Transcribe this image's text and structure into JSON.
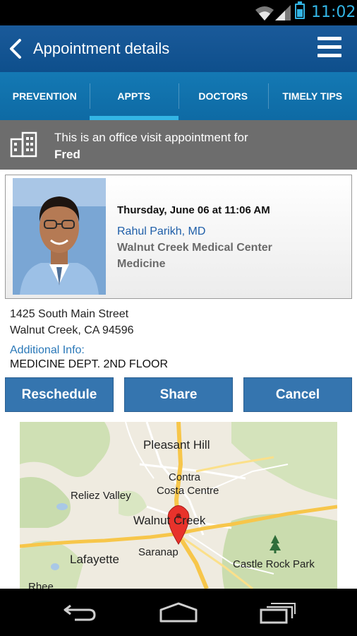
{
  "status_bar": {
    "time": "11:02"
  },
  "header": {
    "title": "Appointment details"
  },
  "tabs": [
    {
      "label": "PREVENTION"
    },
    {
      "label": "APPTS"
    },
    {
      "label": "DOCTORS"
    },
    {
      "label": "TIMELY TIPS"
    }
  ],
  "banner": {
    "line1": "This is an office visit appointment for",
    "patient": "Fred"
  },
  "appointment": {
    "datetime": "Thursday, June 06 at 11:06 AM",
    "doctor": "Rahul Parikh, MD",
    "facility": "Walnut Creek Medical Center",
    "department": "Medicine"
  },
  "address": {
    "line1": "1425 South Main Street",
    "line2": "Walnut Creek, CA 94596"
  },
  "additional_info": {
    "label": "Additional Info:",
    "value": "MEDICINE DEPT. 2ND FLOOR"
  },
  "actions": {
    "reschedule": "Reschedule",
    "share": "Share",
    "cancel": "Cancel"
  },
  "map": {
    "labels": {
      "pleasant_hill": "Pleasant Hill",
      "contra": "Contra",
      "costa_centre": "Costa Centre",
      "reliez_valley": "Reliez Valley",
      "walnut_creek": "Walnut Creek",
      "lafayette": "Lafayette",
      "saranap": "Saranap",
      "castle_rock_park": "Castle Rock Park",
      "rheem": "Rhee"
    }
  },
  "colors": {
    "header": "#0e4f8c",
    "tabs": "#1479b4",
    "tab_indicator": "#33b5e5",
    "button": "#3575af",
    "banner": "#6d6d6d",
    "doctor_link": "#1e5ea8"
  },
  "icons": [
    "wifi-icon",
    "signal-icon",
    "battery-icon",
    "back-arrow-icon",
    "menu-icon",
    "building-icon",
    "map-pin-icon",
    "tree-icon",
    "nav-back-icon",
    "nav-home-icon",
    "nav-recents-icon"
  ]
}
